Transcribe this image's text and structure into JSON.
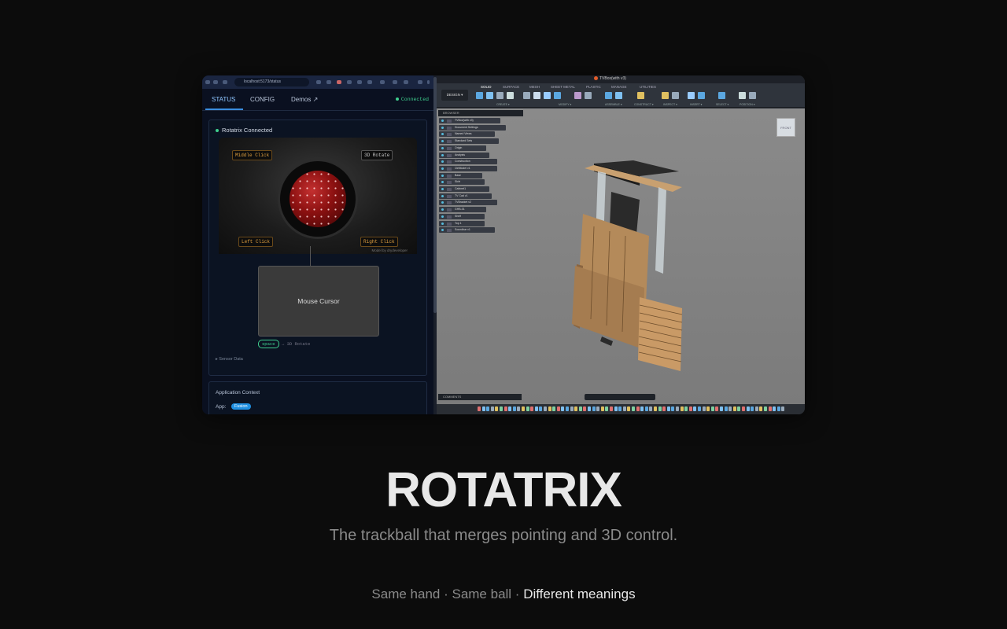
{
  "browser": {
    "address": "localhost:5173/status",
    "tabs": [
      "STATUS",
      "CONFIG",
      "Demos ↗"
    ],
    "connection": "Connected"
  },
  "status_panel": {
    "title": "Rotatrix Connected",
    "labels": {
      "middle_click": "Middle Click",
      "rotate_3d": "3D Rotate",
      "left_click": "Left Click",
      "right_click": "Right Click"
    },
    "model_credit": "Model by drydeveloper"
  },
  "cursor_box": {
    "label": "Mouse Cursor"
  },
  "key_hint": {
    "key": "space",
    "action": "→ 3D Rotate"
  },
  "sensor_data": "▸ Sensor Data",
  "app_context": {
    "title": "Application Context",
    "app_label": "App:",
    "app_value": "Fusion"
  },
  "fusion": {
    "title": "TVBox(with v3)",
    "menu_tabs": [
      "SOLID",
      "SURFACE",
      "MESH",
      "SHEET METAL",
      "PLASTIC",
      "MANAGE",
      "UTILITIES"
    ],
    "design_button": "DESIGN ▾",
    "tool_groups": [
      "CREATE ▾",
      "MODIFY ▾",
      "ASSEMBLE ▾",
      "CONSTRUCT ▾",
      "INSPECT ▾",
      "INSERT ▾",
      "SELECT ▾",
      "POSITION ▾"
    ],
    "browser_label": "BROWSER",
    "tree": [
      "TVBox(with v3)",
      "Document Settings",
      "Named Views",
      "Standard Sets",
      "Origin",
      "Analysis",
      "Construction",
      "CtrlModel v1",
      "Base",
      "Skirt",
      "Cabinet1",
      "TV Cad v1",
      "TVBracket v2",
      "GHB-01",
      "Shelf",
      "Top 1",
      "Soundbar v1"
    ],
    "viewcube": "FRONT",
    "comments_label": "COMMENTS"
  },
  "hero": {
    "title": "ROTATRIX",
    "subtitle": "The trackball that merges pointing and 3D control.",
    "tagline_1": "Same hand · Same ball · ",
    "tagline_2": "Different meanings"
  }
}
